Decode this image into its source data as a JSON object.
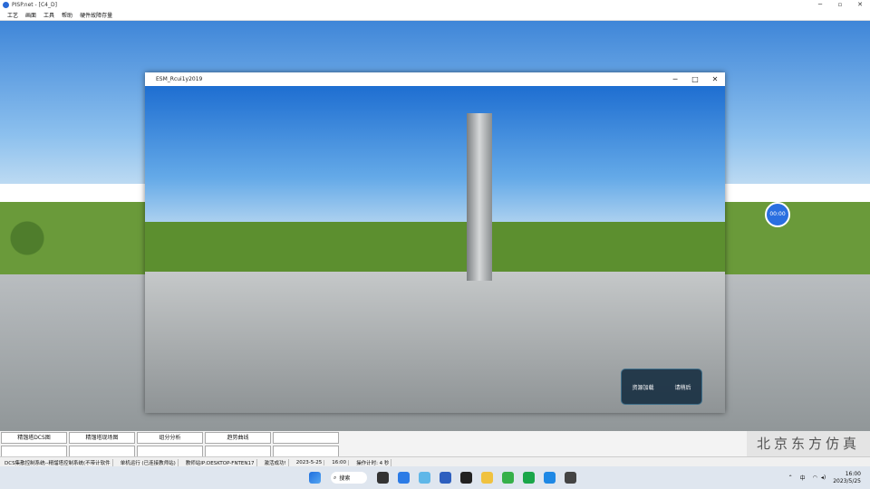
{
  "window": {
    "title": "PISP.net - [C4_D]"
  },
  "menu": [
    "工艺",
    "画面",
    "工具",
    "帮助",
    "硬件故障存量"
  ],
  "inner_window": {
    "title": "ESM_Rcui1y2019"
  },
  "overlay": {
    "timer": "00:00",
    "popup_left": "资源加载",
    "popup_right": "请稍后"
  },
  "buttons": [
    "精馏塔DCS图",
    "精馏塔现场图",
    "组分分析",
    "趋势曲线",
    ""
  ],
  "brand": "北京东方仿真",
  "status": [
    "DCS集散控制系统--精馏塔控制系统(不带计软件",
    "单机运行 (已连接教师站)",
    "教师站IP:DESKTOP-FNTEN17",
    "激活成功!",
    "2023-5-25",
    "16:00",
    "操作计时: 4 秒"
  ],
  "taskbar": {
    "search": "搜索",
    "time": "16:00",
    "date": "2023/5/25"
  }
}
